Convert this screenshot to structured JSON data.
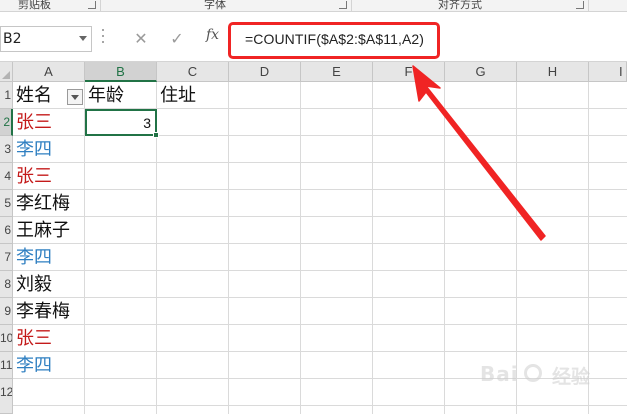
{
  "ribbon": {
    "groups": [
      "剪贴板",
      "字体",
      "对齐方式"
    ]
  },
  "formula_bar": {
    "name_box": "B2",
    "cancel_glyph": "✕",
    "enter_glyph": "✓",
    "fx_label": "fx",
    "formula": "=COUNTIF($A$2:$A$11,A2)"
  },
  "grid": {
    "columns": [
      "A",
      "B",
      "C",
      "D",
      "E",
      "F",
      "G",
      "H",
      "I"
    ],
    "rows": [
      "1",
      "2",
      "3",
      "4",
      "5",
      "6",
      "7",
      "8",
      "9",
      "10",
      "11",
      "12"
    ],
    "headers": {
      "name": "姓名",
      "age": "年龄",
      "address": "住址"
    },
    "names": [
      {
        "text": "张三",
        "color": "#c41a1a"
      },
      {
        "text": "李四",
        "color": "#2f7fc1"
      },
      {
        "text": "张三",
        "color": "#c41a1a"
      },
      {
        "text": "李红梅",
        "color": "#111111"
      },
      {
        "text": "王麻子",
        "color": "#111111"
      },
      {
        "text": "李四",
        "color": "#2f7fc1"
      },
      {
        "text": "刘毅",
        "color": "#111111"
      },
      {
        "text": "李春梅",
        "color": "#111111"
      },
      {
        "text": "张三",
        "color": "#c41a1a"
      },
      {
        "text": "李四",
        "color": "#2f7fc1"
      }
    ],
    "selected_value": "3",
    "active_column": "B",
    "active_row": "2"
  },
  "colors": {
    "annotation": "#f02424",
    "excel_green": "#217346"
  },
  "watermark": {
    "text": "Bai",
    "sub": "经验"
  }
}
